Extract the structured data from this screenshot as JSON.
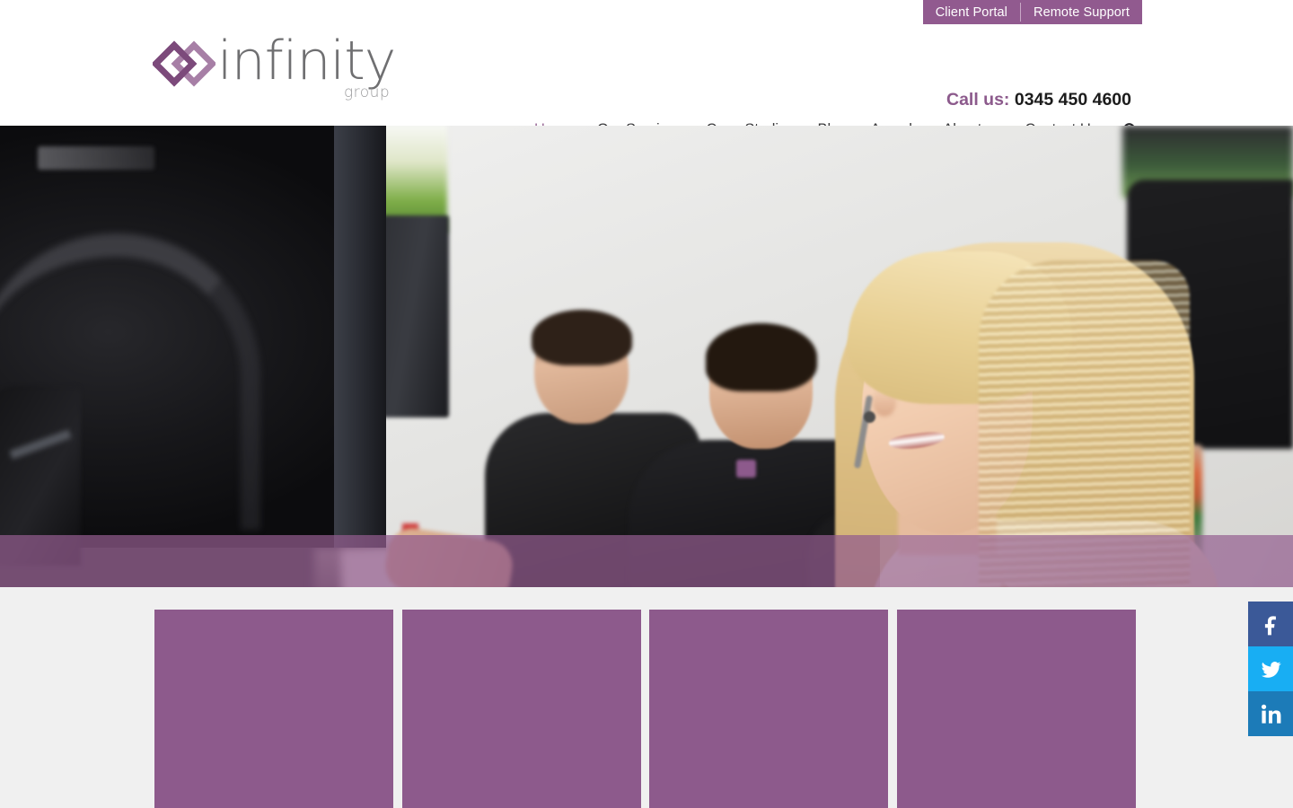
{
  "topbar": {
    "links": [
      {
        "label": "Client Portal",
        "name": "client-portal"
      },
      {
        "label": "Remote Support",
        "name": "remote-support"
      }
    ],
    "background_color": "#915a8f"
  },
  "header": {
    "logo": {
      "word": "infinity",
      "sub": "group",
      "mark_color_dark": "#7c4a7b",
      "mark_color_light": "#a77fa6",
      "word_color": "#6f6f71"
    },
    "call": {
      "label": "Call us:",
      "number": "0345 450 4600",
      "label_color": "#8c5a8c"
    }
  },
  "nav": {
    "items": [
      {
        "label": "Home",
        "active": true
      },
      {
        "label": "Our Services",
        "active": false
      },
      {
        "label": "Case Studies",
        "active": false
      },
      {
        "label": "Blog",
        "active": false
      },
      {
        "label": "Awards",
        "active": false
      },
      {
        "label": "About us",
        "active": false
      },
      {
        "label": "Contact Us",
        "active": false
      }
    ],
    "search_icon": "search-icon",
    "active_color": "#9a6a98"
  },
  "hero": {
    "description": "Office scene: blonde woman wearing a headset smiling at right, two men in black polo shirts working at computers in the background, large dark monitor in the foreground",
    "overlay_band_color": "#925c8e"
  },
  "cards": [
    {
      "title": "",
      "accent": "#8d5a8c"
    },
    {
      "title": "",
      "accent": "#8d5a8c"
    },
    {
      "title": "",
      "accent": "#8d5a8c"
    },
    {
      "title": "",
      "accent": "#8d5a8c"
    }
  ],
  "social": [
    {
      "network": "facebook",
      "glyph": "f",
      "color": "#3b5998",
      "name": "facebook-icon"
    },
    {
      "network": "twitter",
      "glyph": "",
      "color": "#18aef3",
      "name": "twitter-icon"
    },
    {
      "network": "linkedin",
      "glyph": "in",
      "color": "#1c7bb8",
      "name": "linkedin-icon"
    }
  ]
}
